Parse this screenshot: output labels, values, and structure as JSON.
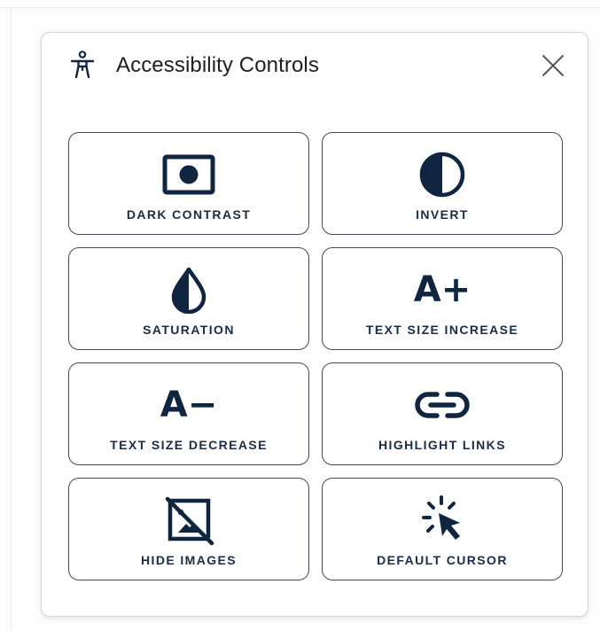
{
  "panel": {
    "title": "Accessibility Controls",
    "header_icon": "accessibility-person-icon",
    "close_icon": "close-icon"
  },
  "colors": {
    "icon": "#0f2540",
    "label": "#1b2d45",
    "tile_border": "#3d4a5c",
    "panel_border": "#d6d6d6"
  },
  "tiles": [
    {
      "label": "DARK CONTRAST",
      "icon": "dark-contrast-icon"
    },
    {
      "label": "INVERT",
      "icon": "invert-icon"
    },
    {
      "label": "SATURATION",
      "icon": "saturation-icon"
    },
    {
      "label": "TEXT SIZE INCREASE",
      "icon": "text-size-increase-icon",
      "glyph": "A+"
    },
    {
      "label": "TEXT SIZE DECREASE",
      "icon": "text-size-decrease-icon",
      "glyph": "A−"
    },
    {
      "label": "HIGHLIGHT LINKS",
      "icon": "link-icon"
    },
    {
      "label": "HIDE IMAGES",
      "icon": "hide-images-icon"
    },
    {
      "label": "DEFAULT CURSOR",
      "icon": "cursor-icon"
    }
  ]
}
